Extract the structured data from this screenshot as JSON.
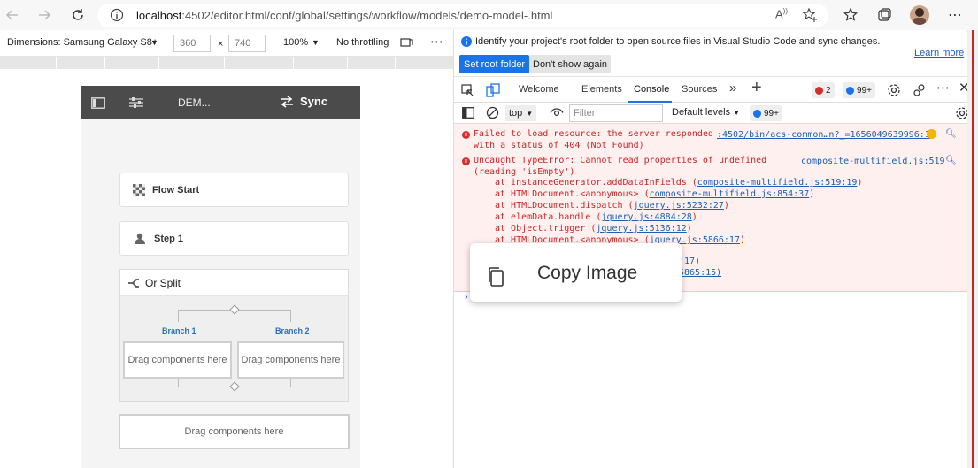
{
  "browser": {
    "url_host": "localhost",
    "url_path": ":4502/editor.html/conf/global/settings/workflow/models/demo-model-.html"
  },
  "device_toolbar": {
    "dimensions_label": "Dimensions: Samsung Galaxy S8+",
    "width": "360",
    "times": "×",
    "height": "740",
    "zoom": "100%",
    "throttling": "No throttling"
  },
  "phone": {
    "header_title": "DEM...",
    "sync_label": "Sync",
    "flow_start": "Flow Start",
    "step1": "Step 1",
    "or_split": "Or Split",
    "branch1": "Branch 1",
    "branch2": "Branch 2",
    "drop1": "Drag components here",
    "drop2": "Drag components here",
    "drop3": "Drag components here"
  },
  "devtools": {
    "info_text": "Identify your project's root folder to open source files in Visual Studio Code and sync changes.",
    "learn_more": "Learn more",
    "set_root_folder": "Set root folder",
    "dont_show_again": "Don't show again",
    "tabs": [
      {
        "label": "Welcome"
      },
      {
        "label": "Elements"
      },
      {
        "label": "Console"
      },
      {
        "label": "Sources"
      }
    ],
    "error_count": "2",
    "info_count": "99+",
    "context": "top",
    "filter_placeholder": "Filter",
    "levels": "Default levels",
    "console_badge": "99+",
    "log": {
      "e1_line1": "Failed to load resource: the server responded",
      "e1_line2": "with a status of 404 (Not Found)",
      "e1_source": ":4502/bin/acs-common…n?_=1656049639996:1",
      "e2_line1": "Uncaught TypeError: Cannot read properties of undefined",
      "e2_line2": "(reading 'isEmpty')",
      "e2_source": "composite-multifield.js:519",
      "stack": [
        {
          "text": "at instanceGenerator.addDataInFields (",
          "link": "composite-multifield.js:519:19",
          "end": ")"
        },
        {
          "text": "at HTMLDocument.<anonymous> (",
          "link": "composite-multifield.js:854:37",
          "end": ")"
        },
        {
          "text": "at HTMLDocument.dispatch (",
          "link": "jquery.js:5232:27",
          "end": ")"
        },
        {
          "text": "at elemData.handle (",
          "link": "jquery.js:4884:28",
          "end": ")"
        },
        {
          "text": "at Object.trigger (",
          "link": "jquery.js:5136:12",
          "end": ")"
        },
        {
          "text": "at HTMLDocument.<anonymous> (",
          "link": "jquery.js:5866:17",
          "end": ")"
        }
      ],
      "partial1": ":17)",
      "partial2": "5865:15)",
      "partial3": ")"
    },
    "prompt": "›"
  },
  "context_menu": {
    "copy_image": "Copy Image"
  },
  "colors": {
    "accent": "#1a73e8",
    "error": "#c62828",
    "phone_header": "#4b4b4b",
    "branch_label": "#2c6fb7"
  }
}
